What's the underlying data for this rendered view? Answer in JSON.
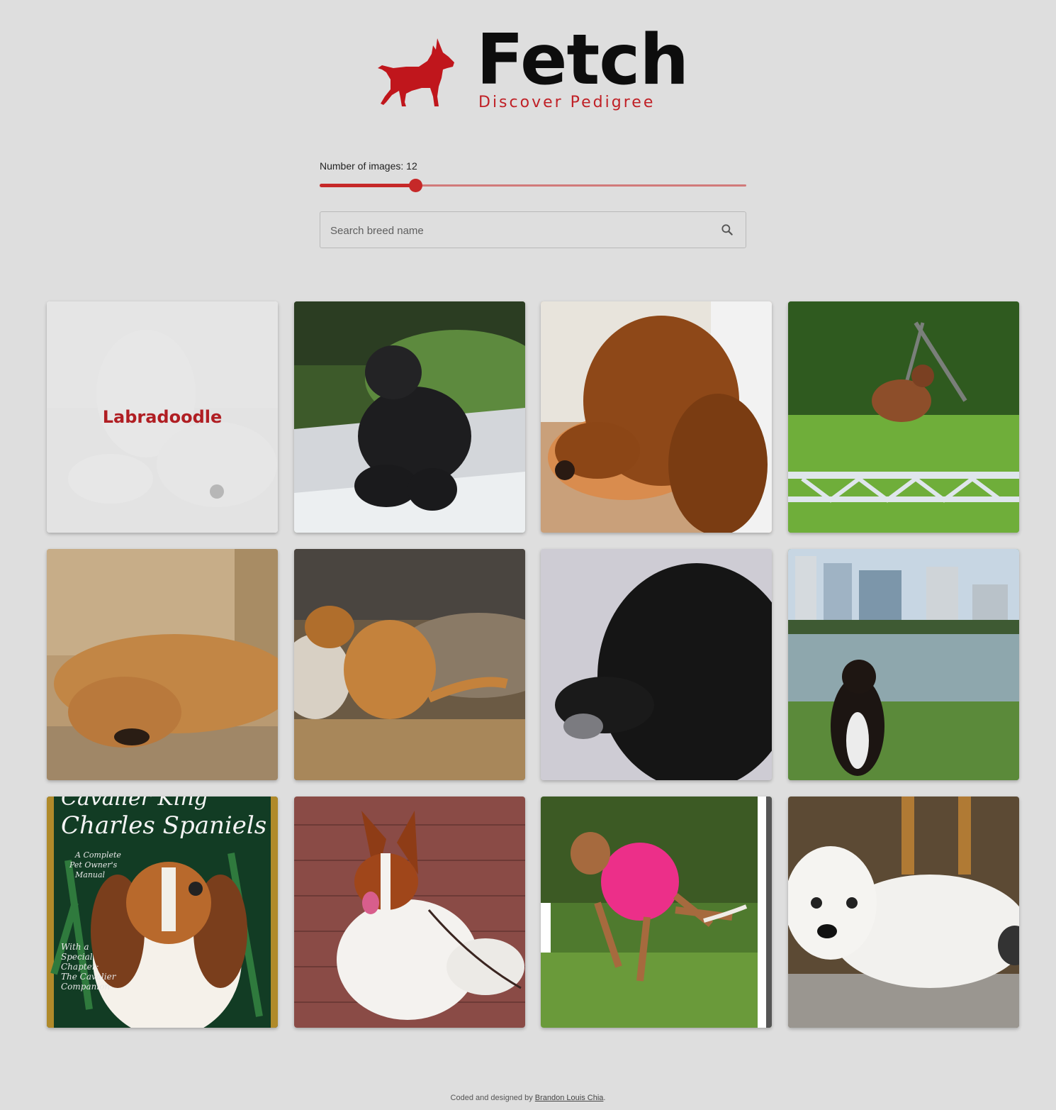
{
  "header": {
    "title": "Fetch",
    "subtitle": "Discover Pedigree",
    "logo_icon": "bull-terrier-silhouette-icon",
    "brand_color": "#c02026"
  },
  "controls": {
    "slider": {
      "label": "Number of images: 12",
      "value": 12,
      "fill_fraction": 0.225
    },
    "search": {
      "placeholder": "Search breed name",
      "value": "",
      "icon": "search-icon"
    }
  },
  "gallery": {
    "images": [
      {
        "hover_label": "Labradoodle",
        "subject": "white labradoodle lying on couch",
        "hovered": true
      },
      {
        "hover_label": "",
        "subject": "black poodle lying on dock"
      },
      {
        "hover_label": "",
        "subject": "irish setter head portrait"
      },
      {
        "hover_label": "",
        "subject": "boxer jumping fence"
      },
      {
        "hover_label": "",
        "subject": "golden doodle sleeping on floor"
      },
      {
        "hover_label": "",
        "subject": "wet dog by rocks"
      },
      {
        "hover_label": "",
        "subject": "black curly-coated retriever in snow"
      },
      {
        "hover_label": "",
        "subject": "border collie by lake with skyline"
      },
      {
        "hover_label": "",
        "subject": "cavalier king charles spaniel book cover"
      },
      {
        "hover_label": "",
        "subject": "papillon on brick pavement"
      },
      {
        "hover_label": "",
        "subject": "whippet in pink vest running"
      },
      {
        "hover_label": "",
        "subject": "west highland white terrier lying down"
      }
    ],
    "book_cover": {
      "title_top": "Cavalier King",
      "title_main": "Charles Spaniels",
      "tagline": [
        "A Complete",
        "Pet Owner's",
        "Manual"
      ],
      "chapter": [
        "With a",
        "Special",
        "Chapter:",
        "The Cavalier",
        "Companion"
      ]
    }
  },
  "footer": {
    "prefix": "Coded and designed by ",
    "author": "Brandon Louis Chia",
    "suffix": "."
  }
}
